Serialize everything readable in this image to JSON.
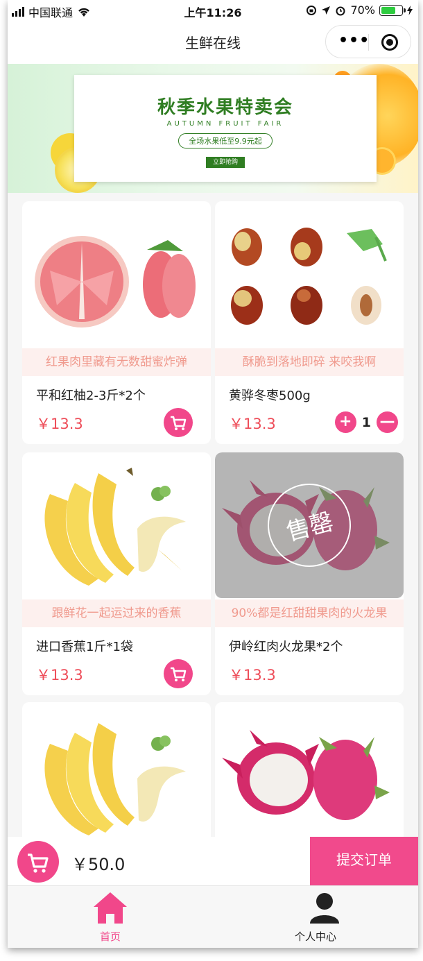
{
  "status_bar": {
    "carrier": "中国联通",
    "time": "上午11:26",
    "battery": "70%",
    "battery_level": 0.7
  },
  "nav": {
    "title": "生鲜在线",
    "more_icon": "more-dots-icon",
    "close_icon": "target-circle-icon"
  },
  "banner": {
    "title": "秋季水果特卖会",
    "subtitle": "AUTUMN FRUIT FAIR",
    "pill": "全场水果低至9.9元起",
    "button": "立即抢购"
  },
  "products": [
    {
      "slogan": "红果肉里藏有无数甜蜜炸弹",
      "name": "平和红柚2-3斤*2个",
      "price": "￥13.3",
      "action": "cart"
    },
    {
      "slogan": "酥脆到落地即碎  来咬我啊",
      "name": "黄骅冬枣500g",
      "price": "￥13.3",
      "action": "quantity",
      "quantity": "1",
      "plus": "+",
      "minus": "—"
    },
    {
      "slogan": "跟鲜花一起运过来的香蕉",
      "name": "进口香蕉1斤*1袋",
      "price": "￥13.3",
      "action": "cart"
    },
    {
      "slogan": "90%都是红甜甜果肉的火龙果",
      "name": "伊岭红肉火龙果*2个",
      "price": "￥13.3",
      "action": "none",
      "soldout_label": "售罄"
    }
  ],
  "cart": {
    "total": "￥50.0",
    "submit_label": "提交订单"
  },
  "tabbar": {
    "items": [
      {
        "label": "首页",
        "icon": "home-icon",
        "active": true
      },
      {
        "label": "个人中心",
        "icon": "person-icon",
        "active": false
      }
    ],
    "active_color": "#f1478a"
  },
  "colors": {
    "accent": "#f1478a",
    "price": "#ee4e5a",
    "slogan": "#f09a8e"
  }
}
